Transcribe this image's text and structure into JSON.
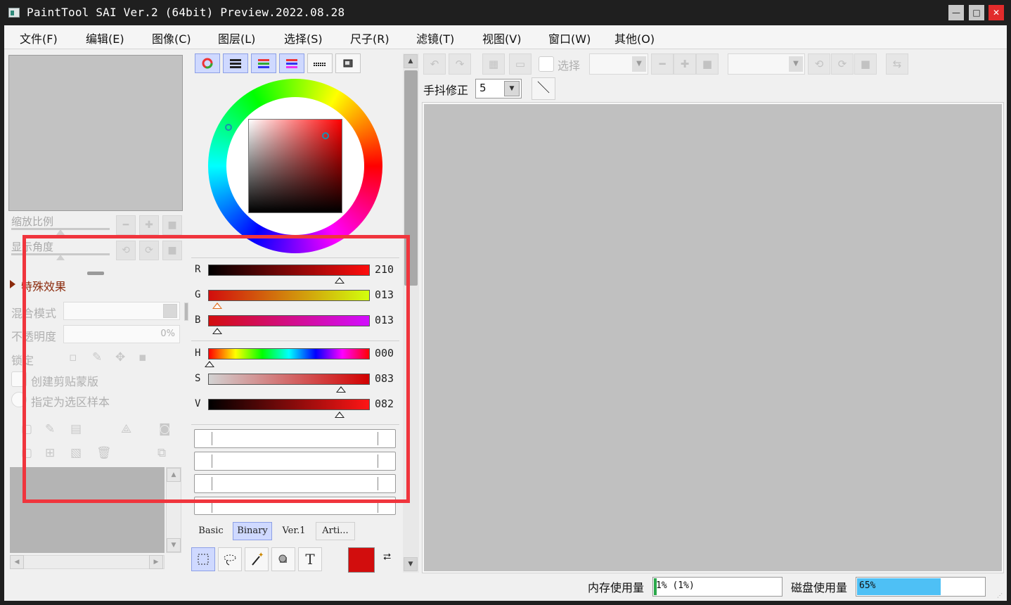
{
  "window": {
    "title": "PaintTool SAI Ver.2 (64bit) Preview.2022.08.28",
    "minimize_glyph": "—",
    "maximize_glyph": "□",
    "close_glyph": "✕"
  },
  "menu": [
    "文件(F)",
    "编辑(E)",
    "图像(C)",
    "图层(L)",
    "选择(S)",
    "尺子(R)",
    "滤镜(T)",
    "视图(V)",
    "窗口(W)",
    "其他(O)"
  ],
  "navigator": {
    "zoom_label": "缩放比例",
    "angle_label": "显示角度"
  },
  "layer_props": {
    "section_title": "特殊效果",
    "blend_label": "混合模式",
    "opacity_label": "不透明度",
    "opacity_value": "0%",
    "lock_label": "锁定",
    "clip_label": "创建剪贴蒙版",
    "sample_label": "指定为选区样本"
  },
  "color": {
    "sliders_rgb": [
      {
        "label": "R",
        "value": "210"
      },
      {
        "label": "G",
        "value": "013"
      },
      {
        "label": "B",
        "value": "013"
      }
    ],
    "sliders_hsv": [
      {
        "label": "H",
        "value": "000"
      },
      {
        "label": "S",
        "value": "083"
      },
      {
        "label": "V",
        "value": "082"
      }
    ],
    "current_color": "#d20d0d"
  },
  "tool_tabs": [
    "Basic",
    "Binary",
    "Ver.1",
    "Arti..."
  ],
  "tools": {
    "text_tool_glyph": "T",
    "swap_glyph": "⮂"
  },
  "toolbar": {
    "select_label": "选择",
    "stabilizer_label": "手抖修正",
    "stabilizer_value": "5"
  },
  "status": {
    "memory_label": "内存使用量",
    "memory_value": "1% (1%)",
    "memory_percent": 1,
    "disk_label": "磁盘使用量",
    "disk_value": "65%",
    "disk_percent": 65
  },
  "colors": {
    "accent_selected": "#cfd9ff",
    "highlight": "#f0353d",
    "disk_bar": "#4ec0f5"
  }
}
